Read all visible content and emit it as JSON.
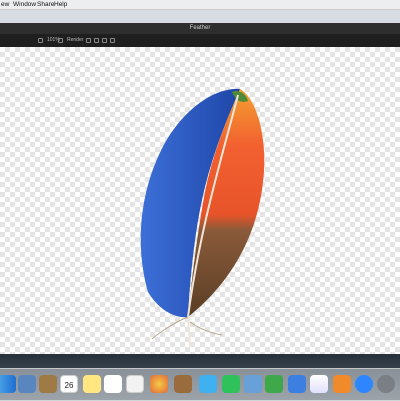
{
  "menubar": {
    "items": [
      "ew",
      "Window",
      "Share",
      "Help"
    ]
  },
  "window": {
    "title": "Feather"
  },
  "toolbar": {
    "zoom": "101%",
    "mode_label": "Render"
  },
  "dock": {
    "calendar_day": "26",
    "apps": [
      "finder-icon",
      "preview-icon",
      "notes-icon",
      "calendar-icon",
      "stickies-icon",
      "reminders-icon",
      "photos-icon",
      "photobooth-icon",
      "facetime-icon",
      "messages-icon",
      "maps-icon",
      "photoscan-icon",
      "numbers-icon",
      "keynote-icon",
      "itunes-icon",
      "ibooks-icon",
      "appstore-icon",
      "settings-icon"
    ]
  },
  "colors": {
    "feather_blue": "#2f5fc8",
    "feather_orange": "#f0552a",
    "feather_brown": "#6b4a2e",
    "dock_bg": "#cdd2d7"
  }
}
